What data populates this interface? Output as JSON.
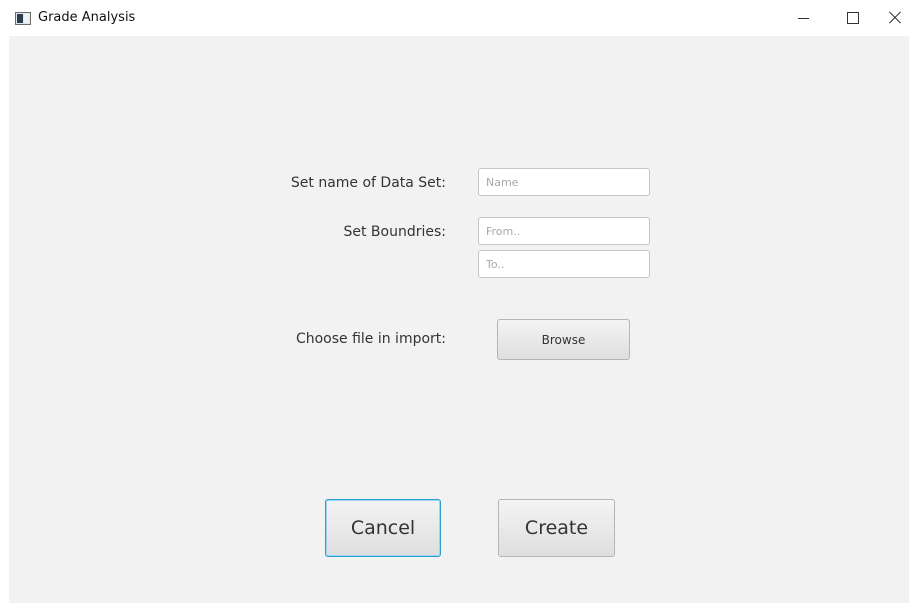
{
  "window": {
    "title": "Grade Analysis",
    "icons": {
      "app": "app-window-icon",
      "minimize": "minimize-icon",
      "maximize": "maximize-icon",
      "close": "close-icon"
    }
  },
  "form": {
    "name_label": "Set name of Data Set:",
    "name_placeholder": "Name",
    "name_value": "",
    "boundaries_label": "Set Boundries:",
    "from_placeholder": "From..",
    "from_value": "",
    "to_placeholder": "To..",
    "to_value": "",
    "file_label": "Choose file in import:",
    "browse_label": "Browse"
  },
  "actions": {
    "cancel_label": "Cancel",
    "create_label": "Create"
  },
  "colors": {
    "content_background": "#f2f2f2",
    "focus_border": "#2a9fd6"
  }
}
